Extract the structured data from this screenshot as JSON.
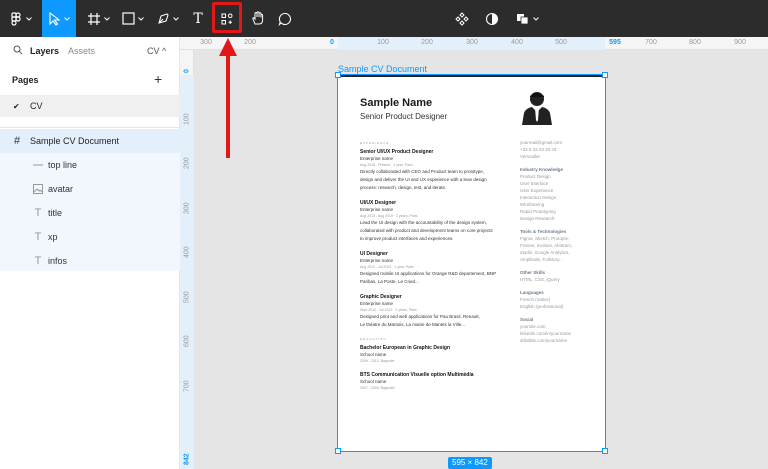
{
  "toolbar": {
    "tools": [
      {
        "name": "main-menu",
        "icon": "figma-logo-icon"
      },
      {
        "name": "move-tool",
        "icon": "cursor-icon"
      },
      {
        "name": "frame-tool",
        "icon": "hash-frame-icon"
      },
      {
        "name": "shape-tool",
        "icon": "rectangle-icon"
      },
      {
        "name": "pen-tool",
        "icon": "pen-icon"
      },
      {
        "name": "text-tool",
        "icon": "text-icon",
        "label": "T"
      },
      {
        "name": "resources-tool",
        "icon": "resources-icon"
      },
      {
        "name": "hand-tool",
        "icon": "hand-icon"
      },
      {
        "name": "comment-tool",
        "icon": "comment-icon"
      }
    ],
    "center_tools": [
      {
        "name": "components",
        "icon": "component-icon"
      },
      {
        "name": "mask",
        "icon": "mask-icon"
      },
      {
        "name": "boolean",
        "icon": "boolean-union-icon"
      }
    ],
    "accent_color": "#0d99ff",
    "highlight_color": "#e01818"
  },
  "left_panel": {
    "tab_layers": "Layers",
    "tab_assets": "Assets",
    "page_selector": "CV ^",
    "pages_heading": "Pages",
    "add_page": "+",
    "pages": [
      {
        "name": "CV",
        "selected": true
      }
    ],
    "frame": {
      "name": "Sample CV Document"
    },
    "layers": [
      {
        "name": "top line",
        "icon": "line-icon"
      },
      {
        "name": "avatar",
        "icon": "image-icon"
      },
      {
        "name": "title",
        "icon": "text-icon"
      },
      {
        "name": "xp",
        "icon": "text-icon"
      },
      {
        "name": "infos",
        "icon": "text-icon"
      }
    ]
  },
  "rulers": {
    "top": [
      "300",
      "200",
      "0",
      "100",
      "200",
      "300",
      "400",
      "500",
      "595",
      "700",
      "800",
      "900"
    ],
    "left": [
      "0",
      "100",
      "200",
      "300",
      "400",
      "500",
      "600",
      "700",
      "842"
    ]
  },
  "canvas": {
    "frame_label": "Sample CV Document",
    "frame_size": "595 × 842"
  },
  "cv": {
    "name": "Sample Name",
    "role": "Senior Product Designer",
    "experience_label": "EXPERIENCE",
    "jobs": [
      {
        "title": "Senior UI/UX Product Designer",
        "company": "Enterprise name",
        "dates": "Aug 2018 - Présent · 1 year, Paris",
        "desc": [
          "Directly collaborated with CEO and Product team to prototype,",
          "design and deliver the UI and UX experience with a lean design",
          "process: research, design, test, and iterate."
        ]
      },
      {
        "title": "UI/UX Designer",
        "company": "Enterprise name",
        "dates": "Aug 2013 - Aug 2015 · 2 years, Paris",
        "desc": [
          "Lead the UI design with the accountability of the design system,",
          "collaborated with product and development teams on core projects",
          "to improve product interfaces and experiences."
        ]
      },
      {
        "title": "UI Designer",
        "company": "Enterprise name",
        "dates": "Aug 2012 - Jul 2013 · 1 year, Paris",
        "desc": [
          "Designed mobile UI applications for Orange R&D departement, BNP",
          "Paribas, La Poste, Le Cned..."
        ]
      },
      {
        "title": "Graphic Designer",
        "company": "Enterprise name",
        "dates": "Sept 2010 - Jul 2012 · 2 years, Paris",
        "desc": [
          "Designed print and web applications for Pau Brasil, Renault,",
          "Le théatre du Mantois, La mairie de Mantes la Ville..."
        ]
      }
    ],
    "education_label": "EDUCATION",
    "education": [
      {
        "title": "Bachelor European in Graphic Design",
        "school": "School name",
        "dates": "2009 - 2010, Bagnolet"
      },
      {
        "title": "BTS Communication Visuelle option Multimédia",
        "school": "School name",
        "dates": "2007 - 2009, Bagnolet"
      }
    ],
    "contact": [
      "yourmail@gmail.com",
      "+33 6 33 33 33 33",
      "Versoullet"
    ],
    "sections": [
      {
        "heading": "Industry Knowledge",
        "items": [
          "Product Design",
          "User Interface",
          "User Experience",
          "Interaction Design",
          "Wireframing",
          "Rapid Prototyping",
          "Design Research"
        ]
      },
      {
        "heading": "Tools & Technologies",
        "items": [
          "Figma, Sketch, Protopie,",
          "Framer, Invision, Abstract,",
          "Zeplin, Google Analytics,",
          "Amplitude, Fullstory..."
        ]
      },
      {
        "heading": "Other Skills",
        "items": [
          "HTML, CSS, jQuery"
        ]
      },
      {
        "heading": "Languages",
        "items": [
          "French (native)",
          "English (professional)"
        ]
      },
      {
        "heading": "Social",
        "items": [
          "yoursite.com",
          "linkedin.com/in/yourname",
          "dribbble.com/yourname"
        ]
      }
    ]
  }
}
